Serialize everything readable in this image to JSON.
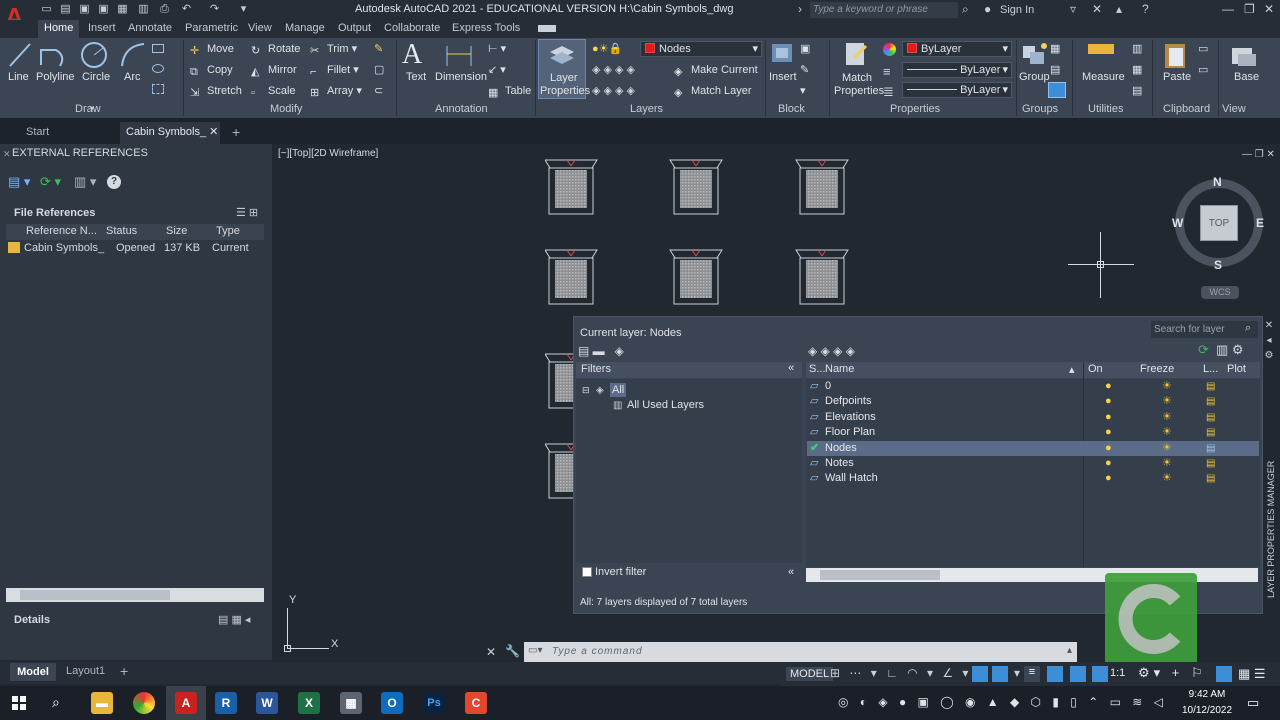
{
  "titlebar": {
    "title": "Autodesk AutoCAD 2021 - EDUCATIONAL VERSION    H:\\Cabin Symbols_dwg",
    "search_placeholder": "Type a keyword or phrase",
    "sign_in": "Sign In",
    "app_letter": "A"
  },
  "ribbon_tabs": [
    "Home",
    "Insert",
    "Annotate",
    "Parametric",
    "View",
    "Manage",
    "Output",
    "Collaborate",
    "Express Tools"
  ],
  "draw": {
    "line": "Line",
    "polyline": "Polyline",
    "circle": "Circle",
    "arc": "Arc",
    "title": "Draw"
  },
  "modify": {
    "move": "Move",
    "rotate": "Rotate",
    "trim": "Trim",
    "copy": "Copy",
    "mirror": "Mirror",
    "fillet": "Fillet",
    "stretch": "Stretch",
    "scale": "Scale",
    "array": "Array",
    "title": "Modify"
  },
  "annotation": {
    "text": "Text",
    "dimension": "Dimension",
    "table": "Table",
    "title": "Annotation"
  },
  "layers": {
    "layer_props_1": "Layer",
    "layer_props_2": "Properties",
    "current": "Nodes",
    "make_current": "Make Current",
    "match_layer": "Match Layer",
    "title": "Layers"
  },
  "block": {
    "insert": "Insert",
    "title": "Block"
  },
  "properties": {
    "match_1": "Match",
    "match_2": "Properties",
    "color": "ByLayer",
    "linetype": "ByLayer",
    "lineweight": "ByLayer",
    "title": "Properties"
  },
  "groups": {
    "group": "Group",
    "title": "Groups"
  },
  "utilities": {
    "measure": "Measure",
    "title": "Utilities"
  },
  "clipboard": {
    "paste": "Paste",
    "title": "Clipboard"
  },
  "view": {
    "base": "Base",
    "title": "View"
  },
  "filetabs": {
    "start": "Start",
    "cabin": "Cabin Symbols_"
  },
  "xref": {
    "title": "EXTERNAL REFERENCES",
    "file_refs": "File References",
    "columns": [
      "Reference N...",
      "Status",
      "Size",
      "Type"
    ],
    "row": {
      "name": "Cabin Symbols_",
      "status": "Opened",
      "size": "137 KB",
      "type": "Current"
    },
    "details": "Details"
  },
  "viewport": {
    "label": "[−][Top][2D Wireframe]",
    "compass": {
      "n": "N",
      "s": "S",
      "e": "E",
      "w": "W",
      "top": "TOP",
      "wcs": "WCS"
    },
    "axis_x": "X",
    "axis_y": "Y"
  },
  "lpm": {
    "current_layer": "Current layer: Nodes",
    "search": "Search for layer",
    "filters": "Filters",
    "filter_all": "All",
    "filter_used": "All Used Layers",
    "invert": "Invert filter",
    "status": "All: 7 layers displayed of 7 total layers",
    "side_title": "LAYER PROPERTIES MANAGER",
    "columns": {
      "s": "S...",
      "name": "Name",
      "on": "On",
      "freeze": "Freeze",
      "lock": "L...",
      "plot": "Plot"
    },
    "layers": [
      {
        "name": "0"
      },
      {
        "name": "Defpoints"
      },
      {
        "name": "Elevations"
      },
      {
        "name": "Floor Plan"
      },
      {
        "name": "Nodes"
      },
      {
        "name": "Notes"
      },
      {
        "name": "Wall Hatch"
      }
    ]
  },
  "command": {
    "placeholder": "Type  a  command"
  },
  "layouts": {
    "model": "Model",
    "layout1": "Layout1"
  },
  "status": {
    "model": "MODEL",
    "scale": "1:1"
  },
  "clock": {
    "time": "9:42 AM",
    "date": "10/12/2022"
  },
  "colors": {
    "accent": "#3c8ed8",
    "current_layer": "#e31a1a",
    "selection": "#5b6c88"
  }
}
